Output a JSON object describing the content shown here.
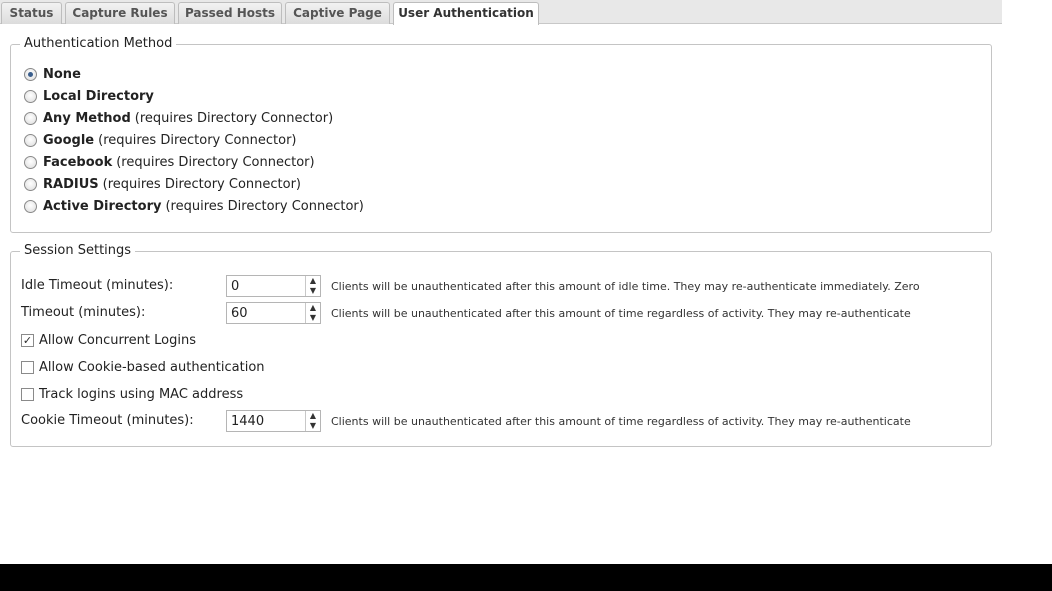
{
  "tabs": [
    {
      "label": "Status"
    },
    {
      "label": "Capture Rules"
    },
    {
      "label": "Passed Hosts"
    },
    {
      "label": "Captive Page"
    },
    {
      "label": "User Authentication",
      "active": true
    }
  ],
  "auth_method": {
    "legend": "Authentication Method",
    "selected": "None",
    "options": [
      {
        "name": "None",
        "requirement": ""
      },
      {
        "name": "Local Directory",
        "requirement": ""
      },
      {
        "name": "Any Method",
        "requirement": "(requires Directory Connector)"
      },
      {
        "name": "Google",
        "requirement": "(requires Directory Connector)"
      },
      {
        "name": "Facebook",
        "requirement": "(requires Directory Connector)"
      },
      {
        "name": "RADIUS",
        "requirement": "(requires Directory Connector)"
      },
      {
        "name": "Active Directory",
        "requirement": "(requires Directory Connector)"
      }
    ]
  },
  "session": {
    "legend": "Session Settings",
    "idle_timeout": {
      "label": "Idle Timeout (minutes):",
      "value": "0",
      "hint": "Clients will be unauthenticated after this amount of idle time. They may re-authenticate immediately. Zero disables idle timeout."
    },
    "timeout": {
      "label": "Timeout (minutes):",
      "value": "60",
      "hint": "Clients will be unauthenticated after this amount of time regardless of activity. They may re-authenticate immediately."
    },
    "concurrent": {
      "label": "Allow Concurrent Logins",
      "checked": true
    },
    "cookie_auth": {
      "label": "Allow Cookie-based authentication",
      "checked": false
    },
    "mac_track": {
      "label": "Track logins using MAC address",
      "checked": false
    },
    "cookie_timeout": {
      "label": "Cookie Timeout (minutes):",
      "value": "1440",
      "hint": "Clients will be unauthenticated after this amount of time regardless of activity. They may re-authenticate immediately."
    }
  },
  "icons": {
    "spin_up": "▲",
    "spin_down": "▼",
    "check": "✓"
  }
}
